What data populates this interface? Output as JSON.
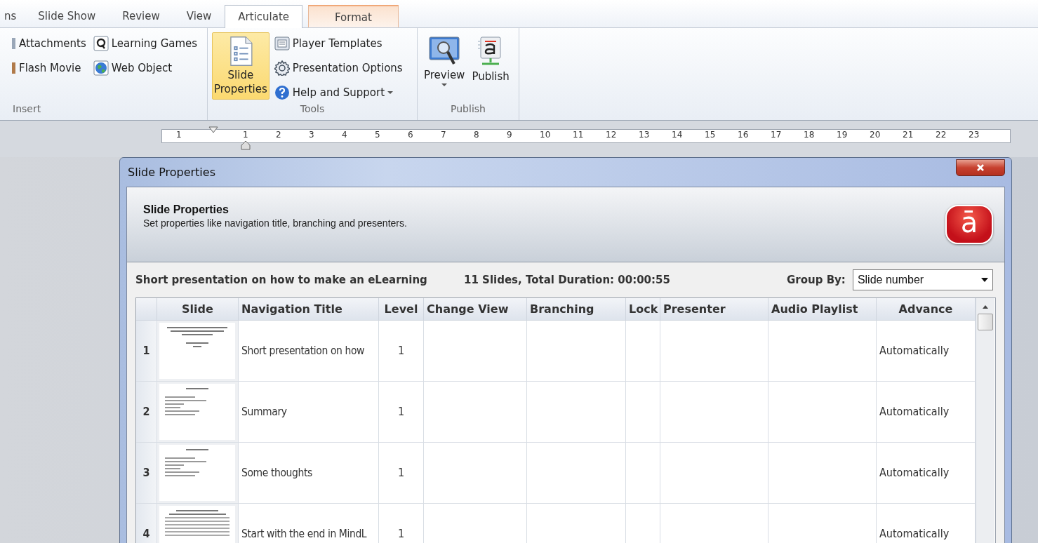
{
  "ribbon": {
    "tabs": [
      {
        "label": "ns",
        "selected": false,
        "kind": "normal"
      },
      {
        "label": "Slide Show",
        "selected": false,
        "kind": "normal"
      },
      {
        "label": "Review",
        "selected": false,
        "kind": "normal"
      },
      {
        "label": "View",
        "selected": false,
        "kind": "normal"
      },
      {
        "label": "Articulate",
        "selected": true,
        "kind": "normal"
      },
      {
        "label": "Format",
        "selected": false,
        "kind": "contextual"
      }
    ],
    "groups": [
      {
        "label": "Insert",
        "columns": [
          [
            {
              "kind": "attachment",
              "label": "Attachments",
              "selected": false
            },
            {
              "kind": "flash",
              "label": "Flash Movie",
              "selected": false
            }
          ],
          [
            {
              "kind": "quiz",
              "label": "Learning Games",
              "selected": false
            },
            {
              "kind": "web",
              "label": "Web Object",
              "selected": false
            }
          ]
        ]
      },
      {
        "label": "Tools",
        "columns": [
          [
            {
              "kind": "slide-properties",
              "label": "Slide Properties",
              "selected": true
            }
          ],
          [
            {
              "kind": "player",
              "label": "Player Templates",
              "selected": false
            },
            {
              "kind": "options",
              "label": "Presentation Options",
              "selected": false
            },
            {
              "kind": "help",
              "label": "Help and Support",
              "selected": false,
              "dropdown": true
            }
          ]
        ]
      },
      {
        "label": "Publish",
        "columns": [
          [
            {
              "kind": "preview",
              "label": "Preview",
              "selected": false,
              "dropdown": true
            }
          ],
          [
            {
              "kind": "publish",
              "label": "Publish",
              "selected": false
            }
          ]
        ]
      }
    ]
  },
  "ruler": {
    "labels": [
      "1",
      "1",
      "2",
      "3",
      "4",
      "5",
      "6",
      "7",
      "8",
      "9",
      "10",
      "11",
      "12",
      "13",
      "14",
      "15",
      "16",
      "17",
      "18",
      "19",
      "20",
      "21",
      "22",
      "23"
    ]
  },
  "dialog": {
    "title": "Slide Properties",
    "heading": "Slide Properties",
    "subtitle": "Set properties like navigation title, branching and presenters.",
    "logo": "ā",
    "project_title": "Short presentation on how to make an eLearning",
    "summary": "11 Slides, Total Duration: 00:00:55",
    "group_by_label": "Group By:",
    "group_by_value": "Slide number",
    "table": {
      "columns": [
        "Slide",
        "Navigation Title",
        "Level",
        "Change View",
        "Branching",
        "Lock",
        "Presenter",
        "Audio Playlist",
        "Advance"
      ],
      "rows": [
        {
          "number": "1",
          "kind": "title",
          "navigation_title": "Short presentation on how",
          "slide_level": "1",
          "advance": "Automatically"
        },
        {
          "number": "2",
          "kind": "bullets",
          "navigation_title": "Summary",
          "slide_level": "1",
          "advance": "Automatically"
        },
        {
          "number": "3",
          "kind": "bullets",
          "navigation_title": "Some thoughts",
          "slide_level": "1",
          "advance": "Automatically"
        },
        {
          "number": "4",
          "kind": "dense",
          "navigation_title": "Start with the end in MindL",
          "slide_level": "1",
          "advance": "Automatically"
        }
      ]
    }
  }
}
